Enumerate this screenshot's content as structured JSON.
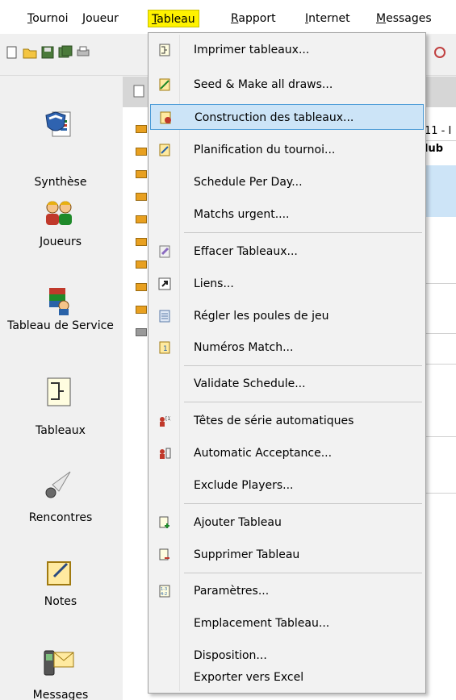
{
  "menubar": {
    "items": [
      {
        "acc": "T",
        "rest": "ournoi"
      },
      {
        "acc": "J",
        "rest": "oueur"
      },
      {
        "acc": "T",
        "rest": "ableau"
      },
      {
        "acc": "R",
        "rest": "apport"
      },
      {
        "acc": "I",
        "rest": "nternet"
      },
      {
        "acc": "M",
        "rest": "essages"
      }
    ],
    "active_color": "#fff200"
  },
  "leftnav": {
    "items": [
      {
        "label": "Synthèse",
        "icon": "shield-document-icon"
      },
      {
        "label": "Joueurs",
        "icon": "players-icon"
      },
      {
        "label": "Tableau de Service",
        "icon": "duty-roster-icon"
      },
      {
        "label": "Tableaux",
        "icon": "draws-icon"
      },
      {
        "label": "Rencontres",
        "icon": "shuttlecock-icon"
      },
      {
        "label": "Notes",
        "icon": "notes-icon"
      },
      {
        "label": "Messages",
        "icon": "messages-icon"
      }
    ]
  },
  "grid": {
    "header": "11 - I",
    "column": "lub"
  },
  "dropdown": {
    "items": [
      {
        "label": "Imprimer tableaux...",
        "icon": "print-draw-icon"
      },
      {
        "label": "Seed & Make all draws...",
        "icon": "seed-draws-icon"
      },
      {
        "label": "Construction des tableaux...",
        "icon": "build-draws-icon",
        "highlight": true
      },
      {
        "label": "Planification du tournoi...",
        "icon": "planning-icon"
      },
      {
        "label": "Schedule Per Day...",
        "icon": ""
      },
      {
        "label": "Matchs urgent....",
        "icon": ""
      },
      {
        "label": "Effacer Tableaux...",
        "icon": "erase-draws-icon"
      },
      {
        "label": "Liens...",
        "icon": "link-icon"
      },
      {
        "label": "Régler les poules de jeu",
        "icon": "pools-icon"
      },
      {
        "label": "Numéros Match...",
        "icon": "match-numbers-icon"
      },
      {
        "label": "Validate Schedule...",
        "icon": ""
      },
      {
        "label": "Têtes de série automatiques",
        "icon": "auto-seeds-icon"
      },
      {
        "label": "Automatic Acceptance...",
        "icon": "auto-acceptance-icon"
      },
      {
        "label": "Exclude Players...",
        "icon": ""
      },
      {
        "label": "Ajouter Tableau",
        "icon": "add-draw-icon"
      },
      {
        "label": "Supprimer Tableau",
        "icon": "delete-draw-icon"
      },
      {
        "label": "Paramètres...",
        "icon": "settings-icon"
      },
      {
        "label": "Emplacement Tableau...",
        "icon": ""
      },
      {
        "label": "Disposition...",
        "icon": ""
      },
      {
        "label": "Exporter vers Excel",
        "icon": ""
      }
    ],
    "highlight_color": "#cce4f7",
    "highlight_border": "#4a9ad6"
  }
}
